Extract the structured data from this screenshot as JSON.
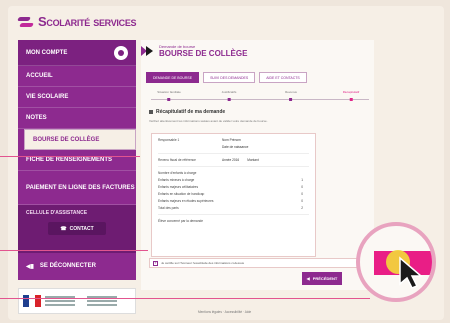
{
  "brand": {
    "logo_text": "Scolarité services"
  },
  "sidebar": {
    "items": [
      {
        "label": "Mon compte"
      },
      {
        "label": "Accueil"
      },
      {
        "label": "Vie scolaire"
      },
      {
        "label": "Notes"
      },
      {
        "label": "Bourse de collège"
      },
      {
        "label": "Fiche de renseignements"
      },
      {
        "label": "Paiement en ligne des factures"
      }
    ],
    "support_label": "Cellule d'assistance",
    "contact_label": "Contact",
    "logout_label": "Se déconnecter"
  },
  "main": {
    "breadcrumb_small": "Demande de bourse",
    "title": "Bourse de collège",
    "tabs": [
      "Demande de bourse",
      "Suivi des demandes",
      "Aide et contacts"
    ],
    "steps": [
      "Situation familiale",
      "Justificatifs",
      "Revenus",
      "Récapitulatif"
    ],
    "section_title": "Récapitulatif de ma demande",
    "intro": "Vérifiez attentivement les informations saisies avant de valider votre demande de bourse.",
    "recap": {
      "rows": [
        {
          "key": "Responsable 1",
          "value": "Nom Prénom"
        },
        {
          "key": "",
          "value": "Date de naissance"
        },
        {
          "key": "Revenu fiscal de référence",
          "value": "Année 2016",
          "value2": "Montant"
        }
      ],
      "section_label": "Nombre d'enfants à charge",
      "lines": [
        {
          "label": "Enfants mineurs à charge",
          "value": "1"
        },
        {
          "label": "Enfants majeurs célibataires",
          "value": "0"
        },
        {
          "label": "Enfants en situation de handicap",
          "value": "0"
        },
        {
          "label": "Enfants majeurs en études supérieures",
          "value": "0"
        },
        {
          "label": "Total des parts",
          "value": "2"
        }
      ],
      "footer_note": "Élève concerné par la demande"
    },
    "certify_text": "Je certifie sur l'honneur l'exactitude des informations ci-dessus",
    "prev_button": "Précédent",
    "footer_text": "Mentions légales · Accessibilité · Aide"
  },
  "colors": {
    "brand": "#8d2a8f",
    "accent": "#e91e86",
    "highlight": "#f2d23c"
  }
}
